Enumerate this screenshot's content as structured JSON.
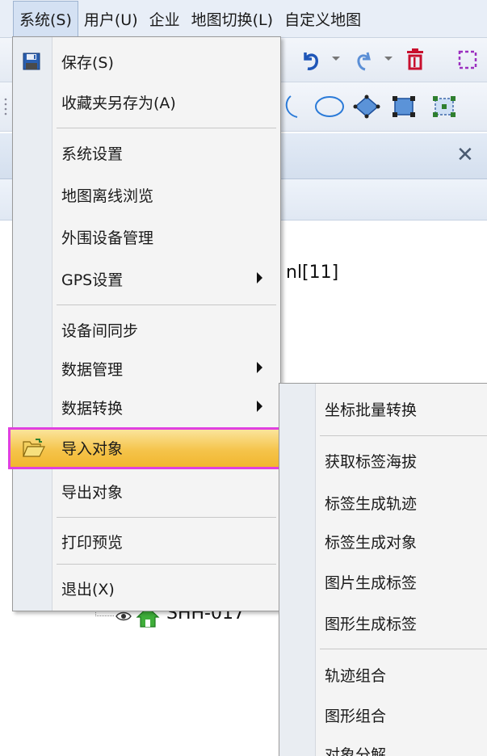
{
  "menubar": {
    "items": [
      {
        "label": "系统(S)",
        "active": true
      },
      {
        "label": "用户(U)"
      },
      {
        "label": "企业"
      },
      {
        "label": "地图切换(L)"
      },
      {
        "label": "自定义地图"
      }
    ]
  },
  "panel": {
    "partial_text": "nl[11]",
    "tree_item": "SHH-017"
  },
  "menu": {
    "items": {
      "save": "保存(S)",
      "save_fav_as": "收藏夹另存为(A)",
      "system_settings": "系统设置",
      "offline_browse": "地图离线浏览",
      "peripheral_mgmt": "外围设备管理",
      "gps_settings": "GPS设置",
      "device_sync": "设备间同步",
      "data_mgmt": "数据管理",
      "data_convert": "数据转换",
      "import_object": "导入对象",
      "export_object": "导出对象",
      "print_preview": "打印预览",
      "exit": "退出(X)"
    }
  },
  "submenu": {
    "items": [
      "坐标批量转换",
      "获取标签海拔",
      "标签生成轨迹",
      "标签生成对象",
      "图片生成标签",
      "图形生成标签",
      "轨迹组合",
      "图形组合",
      "对象分解"
    ]
  },
  "colors": {
    "highlight_outline": "#e040e0",
    "highlight_fill": "#f5c44b"
  }
}
